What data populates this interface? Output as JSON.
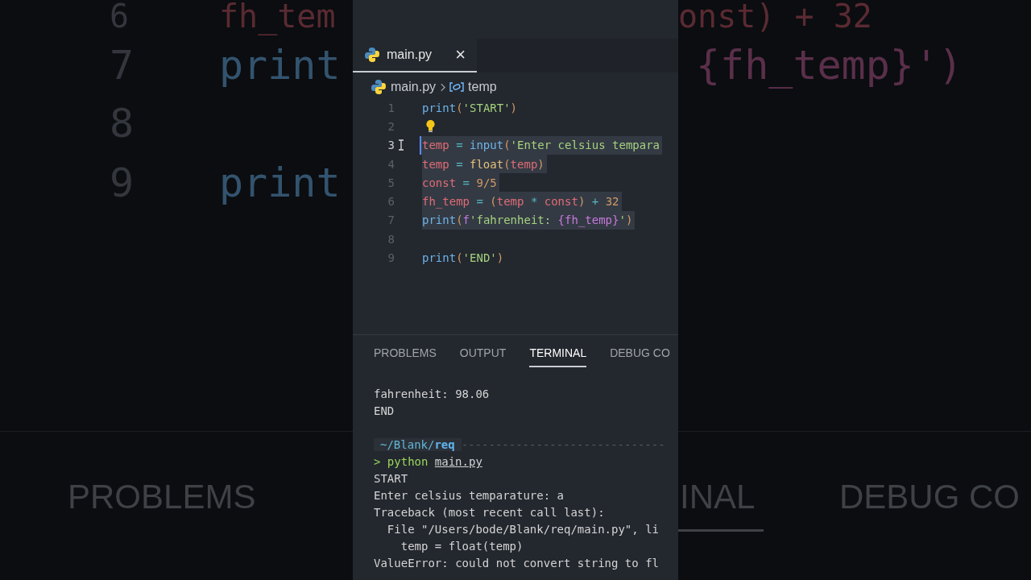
{
  "backdrop_left": [
    {
      "text": "6",
      "kind": "num"
    },
    {
      "text": "fh_tem",
      "kind": "var"
    },
    {
      "text": "7",
      "kind": "num"
    },
    {
      "text": "print",
      "kind": "fn"
    },
    {
      "text": "8",
      "kind": "num"
    },
    {
      "text": "9",
      "kind": "num"
    },
    {
      "text": "print",
      "kind": "fn"
    },
    {
      "text": "PROBLEMS",
      "kind": "tab"
    }
  ],
  "backdrop_right": [
    {
      "text": "onst) + 32",
      "kind": "var"
    },
    {
      "text": "{fh_temp}')",
      "kind": "interp"
    },
    {
      "text": "INAL",
      "kind": "tab"
    },
    {
      "text": "DEBUG CO",
      "kind": "tab"
    }
  ],
  "tabs": [
    {
      "label": "main.py",
      "selected": true,
      "close": "×"
    }
  ],
  "breadcrumb": {
    "file": "main.py",
    "symbol": "temp"
  },
  "lines": [
    {
      "number": "1",
      "selected": false,
      "cursor": false,
      "hint": false,
      "tokens": [
        {
          "text": "print",
          "kind": "fn"
        },
        {
          "text": "(",
          "kind": "paren"
        },
        {
          "text": "'START'",
          "kind": "str"
        },
        {
          "text": ")",
          "kind": "paren"
        }
      ]
    },
    {
      "number": "2",
      "selected": false,
      "cursor": false,
      "hint": true
    },
    {
      "number": "3",
      "selected": true,
      "cursor": true,
      "hint": false,
      "tokens": [
        {
          "text": "temp",
          "kind": "var"
        },
        {
          "text": " = ",
          "kind": "op"
        },
        {
          "text": "input",
          "kind": "fn"
        },
        {
          "text": "(",
          "kind": "paren"
        },
        {
          "text": "'Enter celsius tempara",
          "kind": "str"
        }
      ]
    },
    {
      "number": "4",
      "selected": true,
      "cursor": false,
      "hint": false,
      "tokens": [
        {
          "text": "temp",
          "kind": "var"
        },
        {
          "text": " = ",
          "kind": "op"
        },
        {
          "text": "float",
          "kind": "type"
        },
        {
          "text": "(",
          "kind": "paren"
        },
        {
          "text": "temp",
          "kind": "var"
        },
        {
          "text": ")",
          "kind": "paren"
        }
      ]
    },
    {
      "number": "5",
      "selected": true,
      "cursor": false,
      "hint": false,
      "tokens": [
        {
          "text": "const",
          "kind": "var"
        },
        {
          "text": " = ",
          "kind": "op"
        },
        {
          "text": "9/5",
          "kind": "num"
        }
      ]
    },
    {
      "number": "6",
      "selected": true,
      "cursor": false,
      "hint": false,
      "tokens": [
        {
          "text": "fh_temp",
          "kind": "var"
        },
        {
          "text": " = ",
          "kind": "op"
        },
        {
          "text": "(",
          "kind": "paren"
        },
        {
          "text": "temp",
          "kind": "var"
        },
        {
          "text": " * ",
          "kind": "op"
        },
        {
          "text": "const",
          "kind": "var"
        },
        {
          "text": ")",
          "kind": "paren"
        },
        {
          "text": " + ",
          "kind": "op"
        },
        {
          "text": "32",
          "kind": "num"
        }
      ]
    },
    {
      "number": "7",
      "selected": true,
      "cursor": false,
      "hint": false,
      "tokens": [
        {
          "text": "print",
          "kind": "fn"
        },
        {
          "text": "(",
          "kind": "paren"
        },
        {
          "text": "f",
          "kind": "interp"
        },
        {
          "text": "'fahrenheit: ",
          "kind": "str"
        },
        {
          "text": "{fh_temp}",
          "kind": "interp"
        },
        {
          "text": "'",
          "kind": "str"
        },
        {
          "text": ")",
          "kind": "paren"
        }
      ]
    },
    {
      "number": "8",
      "selected": false,
      "cursor": false,
      "hint": false
    },
    {
      "number": "9",
      "selected": false,
      "cursor": false,
      "hint": false,
      "tokens": [
        {
          "text": "print",
          "kind": "fn"
        },
        {
          "text": "(",
          "kind": "paren"
        },
        {
          "text": "'END'",
          "kind": "str"
        },
        {
          "text": ")",
          "kind": "paren"
        }
      ]
    }
  ],
  "panel_tabs": [
    {
      "label": "PROBLEMS",
      "selected": false
    },
    {
      "label": "OUTPUT",
      "selected": false
    },
    {
      "label": "TERMINAL",
      "selected": true
    },
    {
      "label": "DEBUG CO",
      "selected": false
    }
  ],
  "terminal": {
    "output": [
      {
        "tokens": [
          {
            "text": "fahrenheit: 98.06",
            "kind": "plain"
          }
        ]
      },
      {
        "tokens": [
          {
            "text": "END",
            "kind": "plain"
          }
        ]
      }
    ],
    "session": [
      {
        "tokens": [
          {
            "text": "~/Blank/",
            "kind": "path"
          },
          {
            "text": "req",
            "kind": "dir"
          },
          {
            "text": "------------------------------",
            "kind": "rule"
          }
        ]
      },
      {
        "tokens": [
          {
            "text": "> python",
            "kind": "cmd"
          },
          {
            "text": "main.py",
            "kind": "link"
          }
        ]
      },
      {
        "tokens": [
          {
            "text": "START",
            "kind": "plain"
          }
        ]
      },
      {
        "tokens": [
          {
            "text": "Enter celsius temparature: a",
            "kind": "plain"
          }
        ]
      },
      {
        "tokens": [
          {
            "text": "Traceback (most recent call last):",
            "kind": "plain"
          }
        ]
      },
      {
        "tokens": [
          {
            "text": "  File \"/Users/bode/Blank/req/main.py\", li",
            "kind": "plain"
          }
        ]
      },
      {
        "tokens": [
          {
            "text": "    temp = float(temp)",
            "kind": "plain"
          }
        ]
      },
      {
        "tokens": [
          {
            "text": "ValueError: could not convert string to fl",
            "kind": "plain"
          }
        ]
      }
    ]
  }
}
